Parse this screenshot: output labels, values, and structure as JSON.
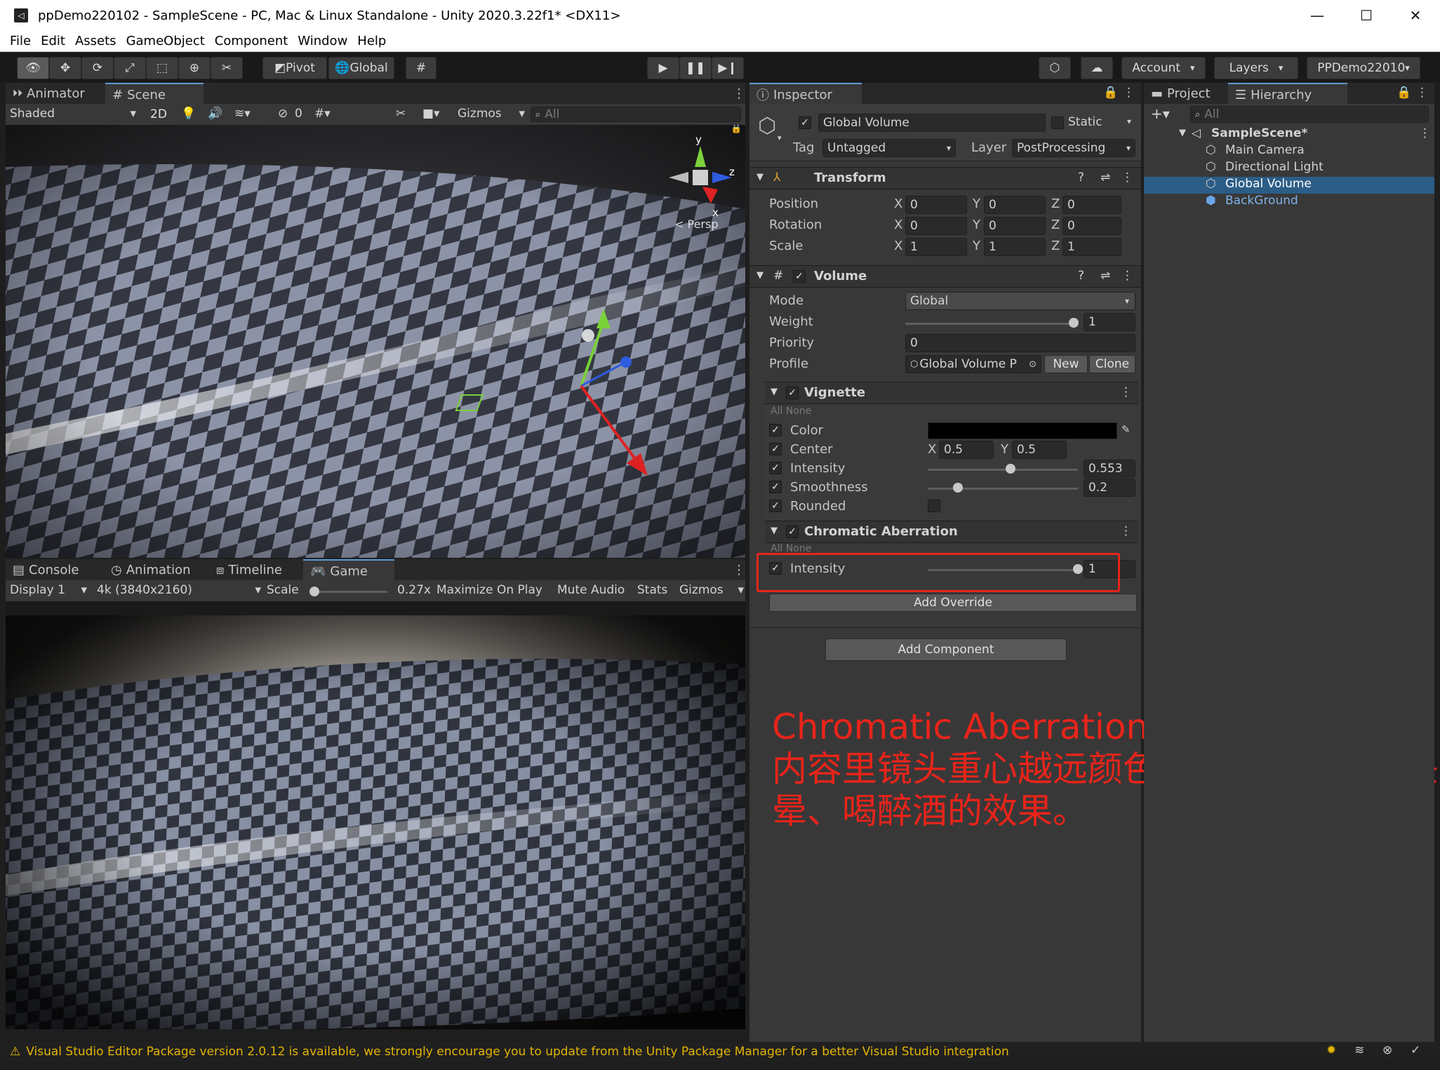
{
  "window": {
    "title": "ppDemo220102 - SampleScene - PC, Mac & Linux Standalone - Unity 2020.3.22f1* <DX11>",
    "controls": [
      "—",
      "☐",
      "✕"
    ]
  },
  "menu": [
    "File",
    "Edit",
    "Assets",
    "GameObject",
    "Component",
    "Window",
    "Help"
  ],
  "toolbar": {
    "pivot": "Pivot",
    "global": "Global",
    "account": "Account",
    "layers": "Layers",
    "layout": "PPDemo22010"
  },
  "scene_panel": {
    "tabs": [
      "Animator",
      "Scene"
    ],
    "shading": "Shaded",
    "mode_2d": "2D",
    "hidden_count": "0",
    "gizmos": "Gizmos",
    "search_placeholder": "All",
    "gizmo_axes": {
      "y": "y",
      "z": "z",
      "x": "x"
    },
    "persp": "Persp"
  },
  "game_panel": {
    "tabs": [
      "Console",
      "Animation",
      "Timeline",
      "Game"
    ],
    "display": "Display 1",
    "resolution": "4k (3840x2160)",
    "scale_label": "Scale",
    "scale_value": "0.27x",
    "scale_fraction": 0.0,
    "maximize": "Maximize On Play",
    "mute": "Mute Audio",
    "stats": "Stats",
    "gizmos": "Gizmos"
  },
  "inspector": {
    "tab": "Inspector",
    "object_name": "Global Volume",
    "static_label": "Static",
    "tag_label": "Tag",
    "tag_value": "Untagged",
    "layer_label": "Layer",
    "layer_value": "PostProcessing",
    "transform": {
      "title": "Transform",
      "rows": [
        {
          "label": "Position",
          "x": "0",
          "y": "0",
          "z": "0"
        },
        {
          "label": "Rotation",
          "x": "0",
          "y": "0",
          "z": "0"
        },
        {
          "label": "Scale",
          "x": "1",
          "y": "1",
          "z": "1"
        }
      ]
    },
    "volume": {
      "title": "Volume",
      "mode_label": "Mode",
      "mode_value": "Global",
      "weight_label": "Weight",
      "weight_value": "1",
      "weight_fraction": 1.0,
      "priority_label": "Priority",
      "priority_value": "0",
      "profile_label": "Profile",
      "profile_value": "Global Volume P",
      "new_btn": "New",
      "clone_btn": "Clone"
    },
    "vignette": {
      "title": "Vignette",
      "all_none": "All  None",
      "color_label": "Color",
      "color_value": "#000000",
      "center_label": "Center",
      "center_x": "0.5",
      "center_y": "0.5",
      "intensity_label": "Intensity",
      "intensity_value": "0.553",
      "intensity_fraction": 0.553,
      "smoothness_label": "Smoothness",
      "smoothness_value": "0.2",
      "smoothness_fraction": 0.2,
      "rounded_label": "Rounded"
    },
    "chromatic": {
      "title": "Chromatic Aberration",
      "all_none": "All  None",
      "intensity_label": "Intensity",
      "intensity_value": "1",
      "intensity_fraction": 1.0
    },
    "add_override": "Add Override",
    "add_component": "Add Component"
  },
  "hierarchy": {
    "tabs": [
      "Project",
      "Hierarchy"
    ],
    "search_placeholder": "All",
    "scene": "SampleScene*",
    "items": [
      "Main Camera",
      "Directional Light",
      "Global Volume",
      "BackGround"
    ]
  },
  "annotation": {
    "title": "Chromatic Aberration",
    "body_line1": "内容里镜头重心越远颜色偏移越大，类似头",
    "body_line2": "晕、喝醉酒的效果。",
    "color": "#e8241a"
  },
  "status": {
    "message": "Visual Studio Editor Package version 2.0.12 is available, we strongly encourage you to update from the Unity Package Manager for a better Visual Studio integration"
  }
}
